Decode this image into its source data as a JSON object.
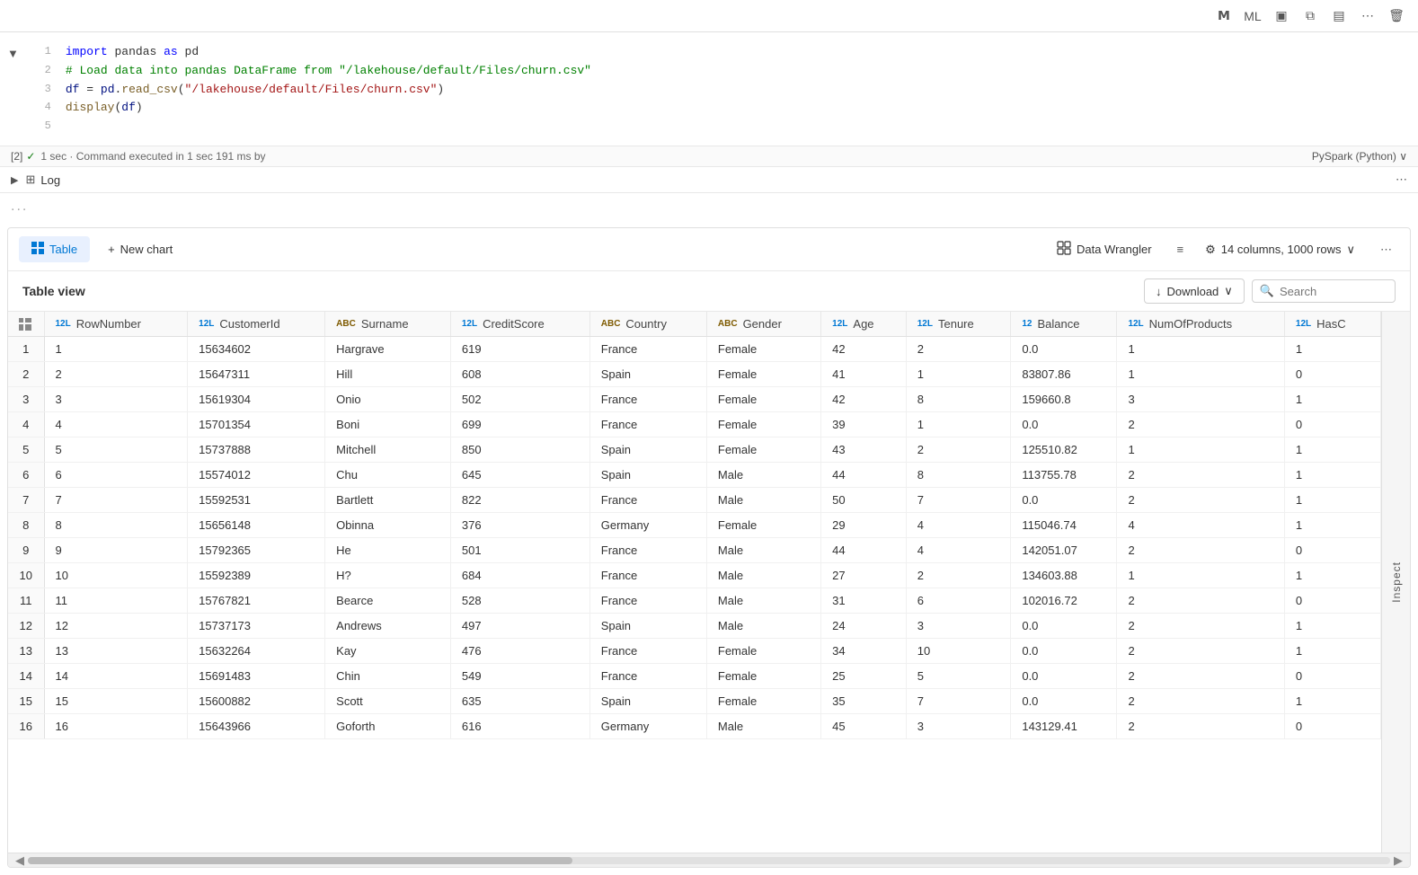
{
  "toolbar": {
    "icons": [
      "M",
      "I",
      "▣",
      "⧉",
      "▤",
      "⋯",
      "🗑"
    ]
  },
  "cell": {
    "number": "[2]",
    "lines": [
      {
        "num": 1,
        "content": [
          {
            "type": "kw",
            "text": "import"
          },
          {
            "type": "plain",
            "text": " pandas "
          },
          {
            "type": "kw",
            "text": "as"
          },
          {
            "type": "plain",
            "text": " pd"
          }
        ]
      },
      {
        "num": 2,
        "content": [
          {
            "type": "cm",
            "text": "# Load data into pandas DataFrame from \"/lakehouse/default/Files/churn.csv\""
          }
        ]
      },
      {
        "num": 3,
        "content": [
          {
            "type": "id",
            "text": "df"
          },
          {
            "type": "plain",
            "text": " = "
          },
          {
            "type": "id",
            "text": "pd"
          },
          {
            "type": "plain",
            "text": "."
          },
          {
            "type": "fn",
            "text": "read_csv"
          },
          {
            "type": "plain",
            "text": "("
          },
          {
            "type": "st",
            "text": "\"/lakehouse/default/Files/churn.csv\""
          },
          {
            "type": "plain",
            "text": ")"
          }
        ]
      },
      {
        "num": 4,
        "content": [
          {
            "type": "fn",
            "text": "display"
          },
          {
            "type": "plain",
            "text": "("
          },
          {
            "type": "id",
            "text": "df"
          },
          {
            "type": "plain",
            "text": ")"
          }
        ]
      },
      {
        "num": 5,
        "content": []
      }
    ],
    "exec_status": "✓  1 sec · Command executed in 1 sec 191 ms by",
    "runtime": "PySpark (Python) ∨"
  },
  "log": {
    "label": "Log"
  },
  "dots": "...",
  "table_panel": {
    "tab_table": "Table",
    "btn_new_chart": "+ New chart",
    "btn_data_wrangler": "Data Wrangler",
    "columns_info": "14 columns, 1000 rows",
    "view_title": "Table view",
    "btn_download": "Download",
    "btn_search": "Search",
    "columns": [
      {
        "type": "12L",
        "name": "RowNumber"
      },
      {
        "type": "12L",
        "name": "CustomerId"
      },
      {
        "type": "ABC",
        "name": "Surname"
      },
      {
        "type": "12L",
        "name": "CreditScore"
      },
      {
        "type": "ABC",
        "name": "Country"
      },
      {
        "type": "ABC",
        "name": "Gender"
      },
      {
        "type": "12L",
        "name": "Age"
      },
      {
        "type": "12L",
        "name": "Tenure"
      },
      {
        "type": "12",
        "name": "Balance"
      },
      {
        "type": "12L",
        "name": "NumOfProducts"
      },
      {
        "type": "12L",
        "name": "HasC"
      }
    ],
    "rows": [
      [
        1,
        1,
        15634602,
        "Hargrave",
        619,
        "France",
        "Female",
        42,
        2,
        "0.0",
        1,
        1
      ],
      [
        2,
        2,
        15647311,
        "Hill",
        608,
        "Spain",
        "Female",
        41,
        1,
        "83807.86",
        1,
        0
      ],
      [
        3,
        3,
        15619304,
        "Onio",
        502,
        "France",
        "Female",
        42,
        8,
        "159660.8",
        3,
        1
      ],
      [
        4,
        4,
        15701354,
        "Boni",
        699,
        "France",
        "Female",
        39,
        1,
        "0.0",
        2,
        0
      ],
      [
        5,
        5,
        15737888,
        "Mitchell",
        850,
        "Spain",
        "Female",
        43,
        2,
        "125510.82",
        1,
        1
      ],
      [
        6,
        6,
        15574012,
        "Chu",
        645,
        "Spain",
        "Male",
        44,
        8,
        "113755.78",
        2,
        1
      ],
      [
        7,
        7,
        15592531,
        "Bartlett",
        822,
        "France",
        "Male",
        50,
        7,
        "0.0",
        2,
        1
      ],
      [
        8,
        8,
        15656148,
        "Obinna",
        376,
        "Germany",
        "Female",
        29,
        4,
        "115046.74",
        4,
        1
      ],
      [
        9,
        9,
        15792365,
        "He",
        501,
        "France",
        "Male",
        44,
        4,
        "142051.07",
        2,
        0
      ],
      [
        10,
        10,
        15592389,
        "H?",
        684,
        "France",
        "Male",
        27,
        2,
        "134603.88",
        1,
        1
      ],
      [
        11,
        11,
        15767821,
        "Bearce",
        528,
        "France",
        "Male",
        31,
        6,
        "102016.72",
        2,
        0
      ],
      [
        12,
        12,
        15737173,
        "Andrews",
        497,
        "Spain",
        "Male",
        24,
        3,
        "0.0",
        2,
        1
      ],
      [
        13,
        13,
        15632264,
        "Kay",
        476,
        "France",
        "Female",
        34,
        10,
        "0.0",
        2,
        1
      ],
      [
        14,
        14,
        15691483,
        "Chin",
        549,
        "France",
        "Female",
        25,
        5,
        "0.0",
        2,
        0
      ],
      [
        15,
        15,
        15600882,
        "Scott",
        635,
        "Spain",
        "Female",
        35,
        7,
        "0.0",
        2,
        1
      ],
      [
        16,
        16,
        15643966,
        "Goforth",
        616,
        "Germany",
        "Male",
        45,
        3,
        "143129.41",
        2,
        0
      ]
    ],
    "inspect_label": "Inspect"
  }
}
